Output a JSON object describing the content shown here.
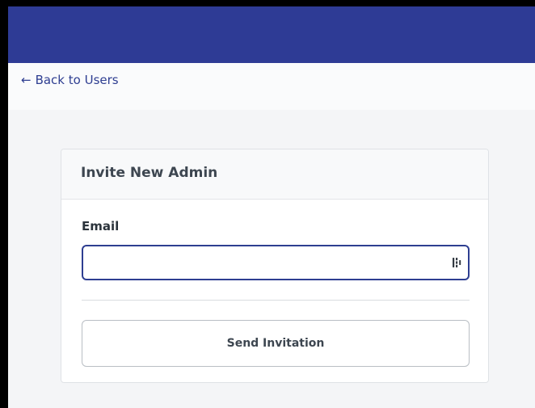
{
  "colors": {
    "header_bg": "#2e3b95",
    "link": "#2e3e91",
    "focus_border": "#2e3e91",
    "page_bg": "#f4f5f7"
  },
  "nav": {
    "back_arrow": "←",
    "back_label": "Back to Users"
  },
  "card": {
    "title": "Invite New Admin",
    "email_label": "Email",
    "email_value": "",
    "send_label": "Send Invitation"
  },
  "icons": {
    "email_field_icon": "password-manager-icon",
    "back_icon": "left-arrow-icon"
  }
}
